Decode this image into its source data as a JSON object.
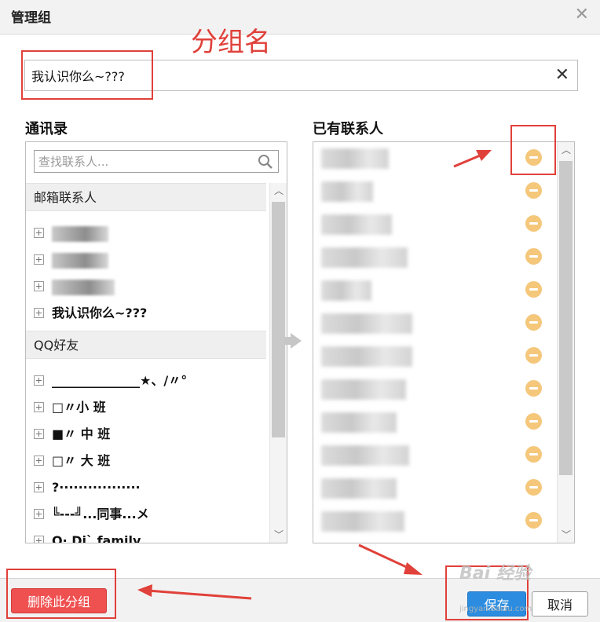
{
  "window": {
    "title": "管理组",
    "close_glyph": "✕"
  },
  "annotation": {
    "label": "分组名",
    "color": "#e0413a"
  },
  "group_name": {
    "value": "我认识你么~???",
    "clear_glyph": "✕"
  },
  "address_book": {
    "title": "通讯录",
    "search_placeholder": "查找联系人...",
    "sections": [
      {
        "label": "邮箱联系人"
      },
      {
        "label": "QQ好友"
      }
    ],
    "email_contacts": [
      "我认识你么~???"
    ],
    "qq_friends": [
      "______________★、/〃°",
      "□〃小 班",
      "■〃 中 班",
      "□〃 大 班",
      "?·················",
      "╚---╝...同事...メ",
      "O· Di` family"
    ]
  },
  "members": {
    "title": "已有联系人",
    "count": 12
  },
  "footer": {
    "delete_label": "删除此分组",
    "save_label": "保存",
    "cancel_label": "取消"
  },
  "watermark": {
    "text": "Bai 经验",
    "sub": "jingyan.baidu.com"
  },
  "colors": {
    "delete": "#ef5050",
    "save": "#2c8de0",
    "remove_icon": "#f4c77a"
  }
}
